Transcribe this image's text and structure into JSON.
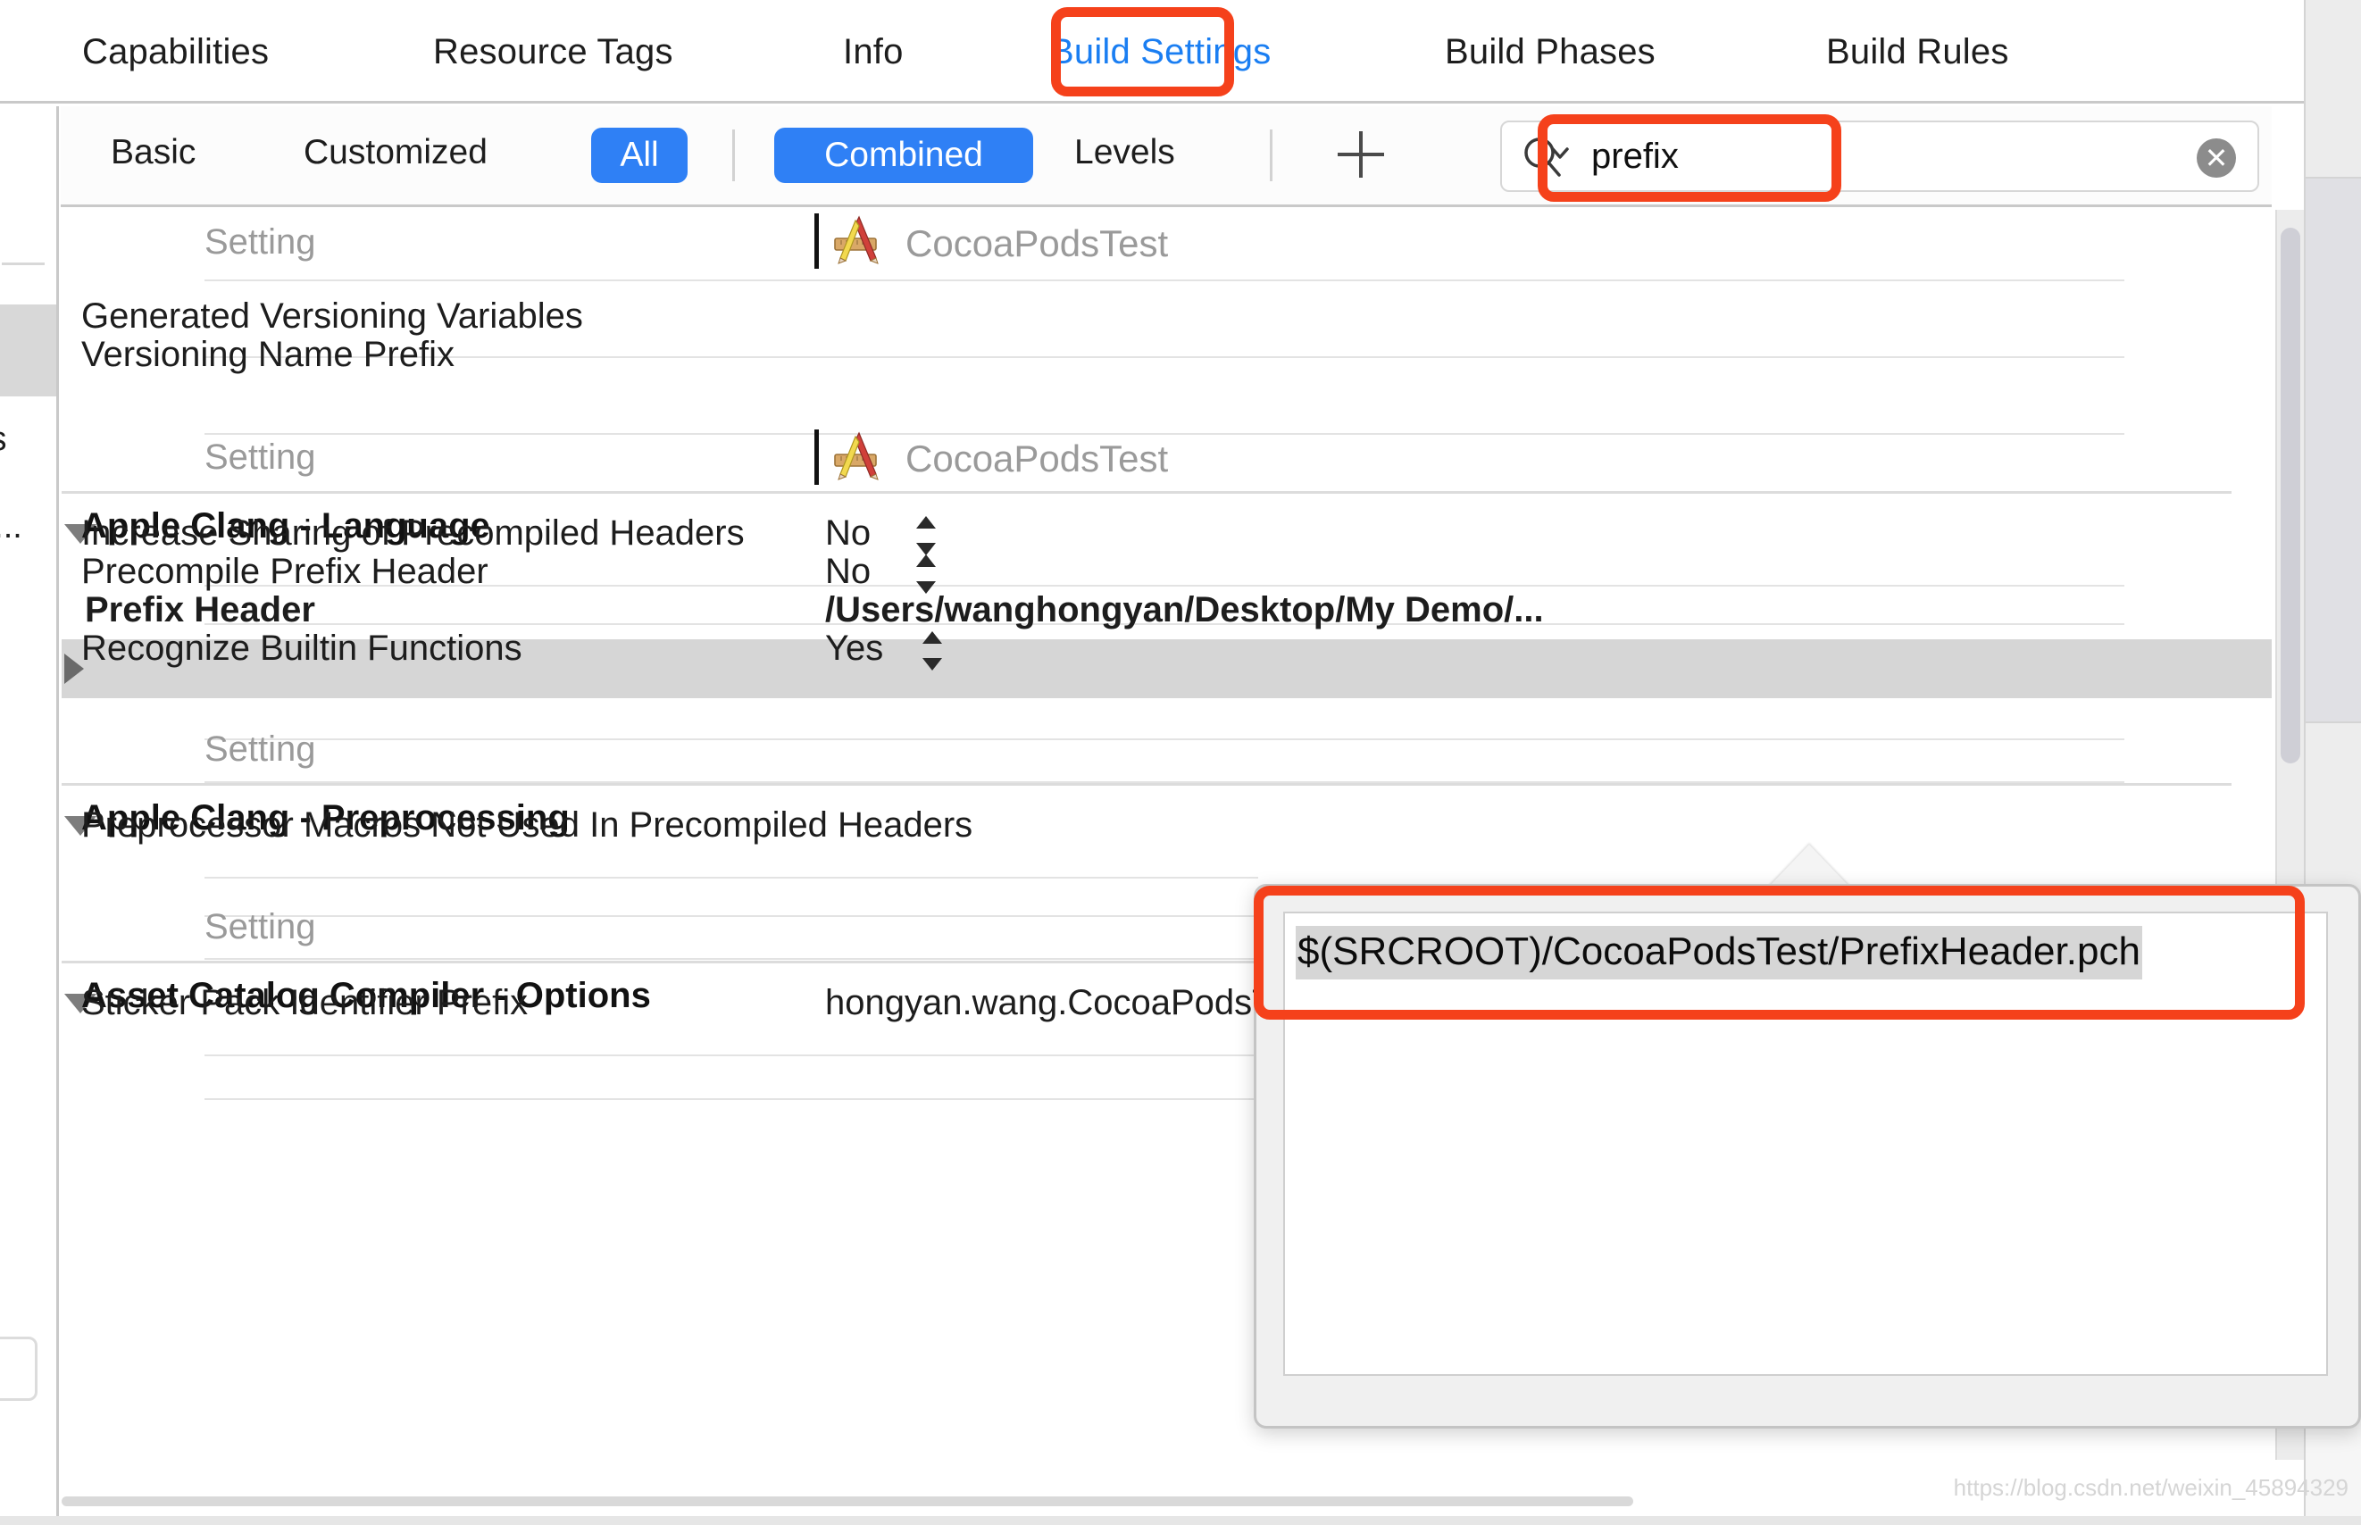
{
  "tabs": [
    {
      "label": "Capabilities",
      "active": false
    },
    {
      "label": "Resource Tags",
      "active": false
    },
    {
      "label": "Info",
      "active": false
    },
    {
      "label": "Build Settings",
      "active": true
    },
    {
      "label": "Build Phases",
      "active": false
    },
    {
      "label": "Build Rules",
      "active": false
    }
  ],
  "toolbar": {
    "basic_label": "Basic",
    "customized_label": "Customized",
    "all_label": "All",
    "combined_label": "Combined",
    "levels_label": "Levels",
    "add_label": "+",
    "active_scope": "All",
    "active_mode": "Combined",
    "accent_blue": "#2f80f5"
  },
  "search": {
    "value": "prefix",
    "placeholder": "",
    "clear_glyph": "✕",
    "icon": "search-icon"
  },
  "columns": {
    "setting_header": "Setting",
    "target_header": "CocoaPodsTest",
    "target_icon": "xcode-app-icon"
  },
  "sidebar_fragments": {
    "item_a": "ts",
    "item_b": "e..."
  },
  "groups": [
    {
      "id": "versioning",
      "title": "",
      "expanded": true,
      "header": {
        "setting": "Setting",
        "target": "CocoaPodsTest"
      },
      "rows": [
        {
          "label": "Generated Versioning Variables",
          "value": "",
          "control": "none",
          "selected": false,
          "expandable": false
        },
        {
          "label": "Versioning Name Prefix",
          "value": "",
          "control": "none",
          "selected": false,
          "expandable": false
        }
      ]
    },
    {
      "id": "apple-clang-language",
      "title": "Apple Clang - Language",
      "expanded": true,
      "header": {
        "setting": "Setting",
        "target": "CocoaPodsTest"
      },
      "rows": [
        {
          "label": "Increase Sharing of Precompiled Headers",
          "value": "No",
          "control": "stepper",
          "selected": false,
          "expandable": false
        },
        {
          "label": "Precompile Prefix Header",
          "value": "No",
          "control": "stepper",
          "selected": false,
          "expandable": false
        },
        {
          "label": "Prefix Header",
          "value": "/Users/wanghongyan/Desktop/My Demo/...",
          "control": "none",
          "selected": true,
          "expandable": true
        },
        {
          "label": "Recognize Builtin Functions",
          "value": "Yes",
          "control": "stepper",
          "selected": false,
          "expandable": false
        }
      ]
    },
    {
      "id": "apple-clang-preprocessing",
      "title": "Apple Clang - Preprocessing",
      "expanded": true,
      "header": {
        "setting": "Setting",
        "target": ""
      },
      "rows": [
        {
          "label": "Preprocessor Macros Not Used In Precompiled Headers",
          "value": "",
          "control": "none",
          "selected": false,
          "expandable": false
        }
      ]
    },
    {
      "id": "asset-catalog-compiler-options",
      "title": "Asset Catalog Compiler - Options",
      "expanded": true,
      "header": {
        "setting": "Setting",
        "target": ""
      },
      "rows": [
        {
          "label": "Sticker Pack Identifier Prefix",
          "value": "hongyan.wang.CocoaPodsTest.sticker-pack.",
          "control": "none",
          "selected": false,
          "expandable": false
        }
      ]
    }
  ],
  "popover": {
    "value": "$(SRCROOT)/CocoaPodsTest/PrefixHeader.pch",
    "selected": true
  },
  "annotations": {
    "color": "#f5411b",
    "items": [
      {
        "name": "build-settings-tab-highlight"
      },
      {
        "name": "search-field-highlight"
      },
      {
        "name": "popover-value-highlight"
      }
    ]
  },
  "watermark": {
    "text": "https://blog.csdn.net/weixin_45894329"
  }
}
